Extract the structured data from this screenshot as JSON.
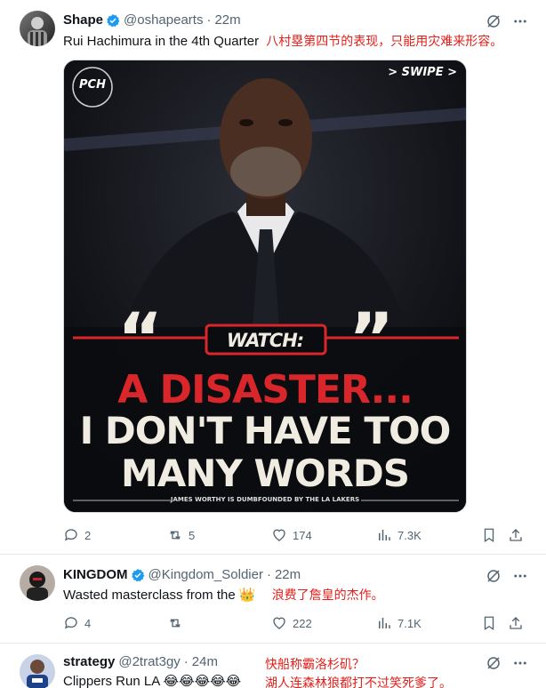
{
  "tweets": [
    {
      "name": "Shape",
      "handle": "@oshapearts",
      "sep": "·",
      "time": "22m",
      "text": "Rui Hachimura in the 4th Quarter",
      "translation": "八村塁第四节的表现，只能用灾难来形容。",
      "media": {
        "swipe": "> SWIPE >",
        "logo": "PCH",
        "watch": "WATCH:",
        "line1": "A DISASTER...",
        "line2": "I DON'T HAVE TOO",
        "line3": "MANY WORDS",
        "caption": "JAMES WORTHY IS DUMBFOUNDED BY THE LA LAKERS",
        "accent": "#d8262a"
      },
      "stats": {
        "replies": "2",
        "reposts": "5",
        "likes": "174",
        "views": "7.3K"
      }
    },
    {
      "name": "KINGDOM",
      "handle": "@Kingdom_Soldier",
      "sep": "·",
      "time": "22m",
      "text": "Wasted masterclass from the 👑",
      "translation": "浪费了詹皇的杰作。",
      "stats": {
        "replies": "4",
        "reposts": "",
        "likes": "222",
        "views": "7.1K"
      }
    },
    {
      "name": "strategy",
      "handle": "@2trat3gy",
      "sep": "·",
      "time": "24m",
      "text": "Clippers Run LA 😂😂😂😂😂",
      "translation_1": "快船称霸洛杉矶？",
      "translation_2": "湖人连森林狼都打不过笑死爹了。"
    }
  ],
  "colors": {
    "verified": "#1d9bf0",
    "translation": "#e0201b",
    "muted": "#536471"
  }
}
